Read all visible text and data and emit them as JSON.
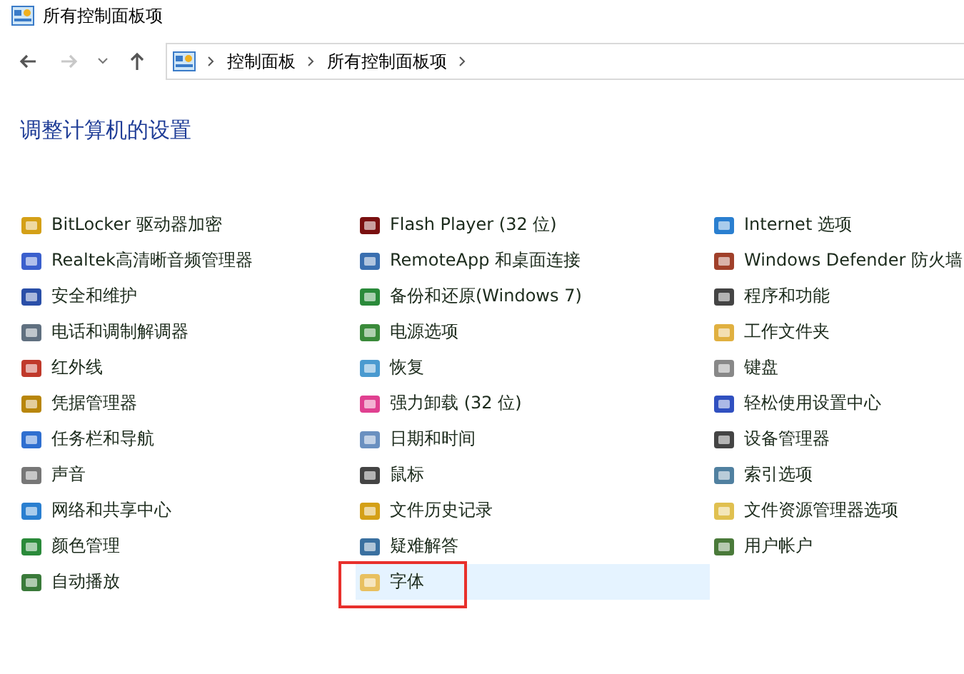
{
  "window": {
    "title": "所有控制面板项"
  },
  "navigation": {
    "back_disabled": false,
    "forward_disabled": true,
    "breadcrumbs": [
      "控制面板",
      "所有控制面板项"
    ]
  },
  "heading": "调整计算机的设置",
  "columns": [
    {
      "items": [
        {
          "label": "BitLocker 驱动器加密",
          "selected": false,
          "annotated": false
        },
        {
          "label": "Realtek高清晰音频管理器",
          "selected": false,
          "annotated": false
        },
        {
          "label": "安全和维护",
          "selected": false,
          "annotated": false
        },
        {
          "label": "电话和调制解调器",
          "selected": false,
          "annotated": false
        },
        {
          "label": "红外线",
          "selected": false,
          "annotated": false
        },
        {
          "label": "凭据管理器",
          "selected": false,
          "annotated": false
        },
        {
          "label": "任务栏和导航",
          "selected": false,
          "annotated": false
        },
        {
          "label": "声音",
          "selected": false,
          "annotated": false
        },
        {
          "label": "网络和共享中心",
          "selected": false,
          "annotated": false
        },
        {
          "label": "颜色管理",
          "selected": false,
          "annotated": false
        },
        {
          "label": "自动播放",
          "selected": false,
          "annotated": false
        }
      ]
    },
    {
      "items": [
        {
          "label": "Flash Player (32 位)",
          "selected": false,
          "annotated": false
        },
        {
          "label": "RemoteApp 和桌面连接",
          "selected": false,
          "annotated": false
        },
        {
          "label": "备份和还原(Windows 7)",
          "selected": false,
          "annotated": false
        },
        {
          "label": "电源选项",
          "selected": false,
          "annotated": false
        },
        {
          "label": "恢复",
          "selected": false,
          "annotated": false
        },
        {
          "label": "强力卸载 (32 位)",
          "selected": false,
          "annotated": false
        },
        {
          "label": "日期和时间",
          "selected": false,
          "annotated": false
        },
        {
          "label": "鼠标",
          "selected": false,
          "annotated": false
        },
        {
          "label": "文件历史记录",
          "selected": false,
          "annotated": false
        },
        {
          "label": "疑难解答",
          "selected": false,
          "annotated": false
        },
        {
          "label": "字体",
          "selected": true,
          "annotated": true
        }
      ]
    },
    {
      "items": [
        {
          "label": "Internet 选项",
          "selected": false,
          "annotated": false
        },
        {
          "label": "Windows Defender 防火墙",
          "selected": false,
          "annotated": false
        },
        {
          "label": "程序和功能",
          "selected": false,
          "annotated": false
        },
        {
          "label": "工作文件夹",
          "selected": false,
          "annotated": false
        },
        {
          "label": "键盘",
          "selected": false,
          "annotated": false
        },
        {
          "label": "轻松使用设置中心",
          "selected": false,
          "annotated": false
        },
        {
          "label": "设备管理器",
          "selected": false,
          "annotated": false
        },
        {
          "label": "索引选项",
          "selected": false,
          "annotated": false
        },
        {
          "label": "文件资源管理器选项",
          "selected": false,
          "annotated": false
        },
        {
          "label": "用户帐户",
          "selected": false,
          "annotated": false
        }
      ]
    }
  ]
}
